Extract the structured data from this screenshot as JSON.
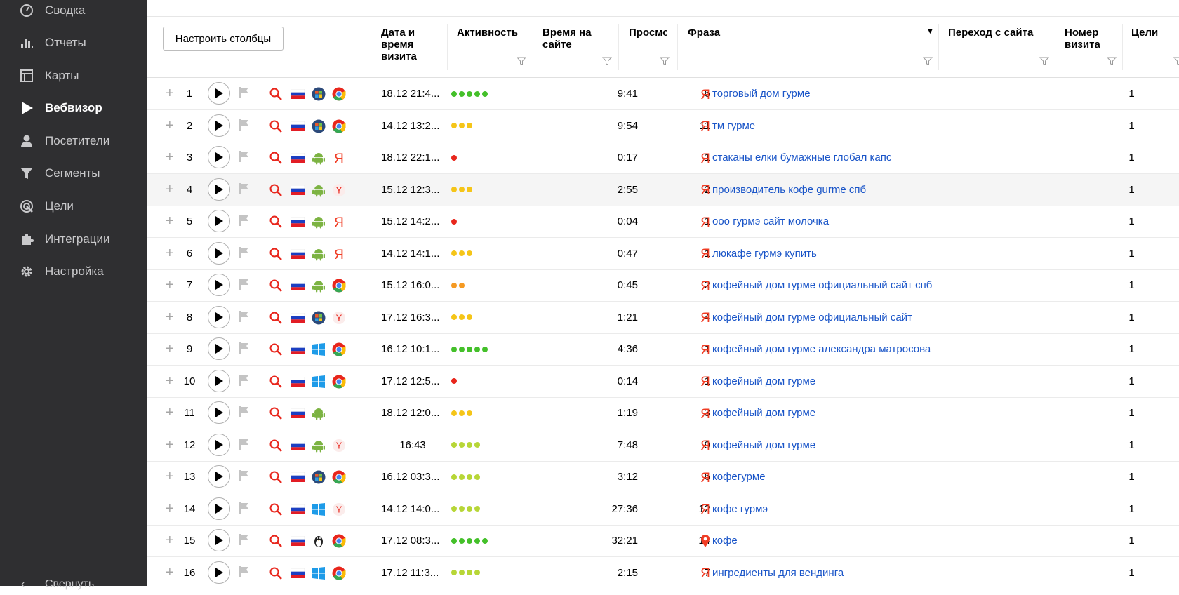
{
  "sidebar": {
    "items": [
      {
        "label": "Сводка",
        "icon": "gauge-icon"
      },
      {
        "label": "Отчеты",
        "icon": "bar-chart-icon"
      },
      {
        "label": "Карты",
        "icon": "map-layout-icon"
      },
      {
        "label": "Вебвизор",
        "icon": "play-icon",
        "active": true
      },
      {
        "label": "Посетители",
        "icon": "person-icon"
      },
      {
        "label": "Сегменты",
        "icon": "funnel-icon"
      },
      {
        "label": "Цели",
        "icon": "target-icon"
      },
      {
        "label": "Интеграции",
        "icon": "puzzle-icon"
      },
      {
        "label": "Настройка",
        "icon": "gear-icon"
      }
    ],
    "collapse_label": "Свернуть"
  },
  "toolbar": {
    "configure_columns": "Настроить столбцы"
  },
  "columns": {
    "datetime": "Дата и время визита",
    "activity": "Активность",
    "time_on_site": "Время на сайте",
    "views": "Просмотры",
    "phrase": "Фраза",
    "referrer": "Переход с сайта",
    "visit_number": "Номер визита",
    "goals": "Цели"
  },
  "colors": {
    "sidebar_bg": "#2f2f31",
    "link": "#1a55c8",
    "activity_green": "#44c02a",
    "activity_yellow": "#f5c518",
    "activity_red": "#e8261c",
    "activity_orange": "#f59a23",
    "activity_lime": "#b7d637"
  },
  "rows": [
    {
      "n": "1",
      "os": "windows7-icon",
      "browser": "chrome-icon",
      "dt": "18.12 21:4...",
      "act": 5,
      "act_color": "green",
      "time": "9:41",
      "views": "6",
      "src": "yandex-icon",
      "phrase": "торговый дом гурме",
      "visit": "1"
    },
    {
      "n": "2",
      "os": "windows7-icon",
      "browser": "chrome-icon",
      "dt": "14.12 13:2...",
      "act": 3,
      "act_color": "yellow",
      "time": "9:54",
      "views": "11",
      "src": "yandex-icon",
      "phrase": "тм гурме",
      "visit": "1"
    },
    {
      "n": "3",
      "os": "android-icon",
      "browser": "yandex-browser-icon",
      "dt": "18.12 22:1...",
      "act": 1,
      "act_color": "red",
      "time": "0:17",
      "views": "1",
      "src": "yandex-icon",
      "phrase": "стаканы елки бумажные глобал капс",
      "visit": "1"
    },
    {
      "n": "4",
      "os": "android-icon",
      "browser": "yandex-y-icon",
      "dt": "15.12 12:3...",
      "act": 3,
      "act_color": "yellow",
      "time": "2:55",
      "views": "2",
      "src": "yandex-icon",
      "phrase": "производитель кофе gurme спб",
      "visit": "1",
      "highlight": true
    },
    {
      "n": "5",
      "os": "android-icon",
      "browser": "yandex-browser-icon",
      "dt": "15.12 14:2...",
      "act": 1,
      "act_color": "red",
      "time": "0:04",
      "views": "1",
      "src": "yandex-icon",
      "phrase": "ооо гурмэ сайт молочка",
      "visit": "1"
    },
    {
      "n": "6",
      "os": "android-icon",
      "browser": "yandex-browser-icon",
      "dt": "14.12 14:1...",
      "act": 3,
      "act_color": "yellow",
      "time": "0:47",
      "views": "1",
      "src": "yandex-icon",
      "phrase": "люкафе гурмэ купить",
      "visit": "1"
    },
    {
      "n": "7",
      "os": "android-icon",
      "browser": "chrome-icon",
      "dt": "15.12 16:0...",
      "act": 2,
      "act_color": "orange",
      "time": "0:45",
      "views": "2",
      "src": "yandex-icon",
      "phrase": "кофейный дом гурме официальный сайт спб",
      "visit": "1"
    },
    {
      "n": "8",
      "os": "windows7-icon",
      "browser": "yandex-y-icon",
      "dt": "17.12 16:3...",
      "act": 3,
      "act_color": "yellow",
      "time": "1:21",
      "views": "4",
      "src": "yandex-icon",
      "phrase": "кофейный дом гурме официальный сайт",
      "visit": "1"
    },
    {
      "n": "9",
      "os": "windows10-icon",
      "browser": "chrome-icon",
      "dt": "16.12 10:1...",
      "act": 5,
      "act_color": "green",
      "time": "4:36",
      "views": "1",
      "src": "yandex-icon",
      "phrase": "кофейный дом гурме александра матросова",
      "visit": "1"
    },
    {
      "n": "10",
      "os": "windows10-icon",
      "browser": "chrome-icon",
      "dt": "17.12 12:5...",
      "act": 1,
      "act_color": "red",
      "time": "0:14",
      "views": "1",
      "src": "yandex-icon",
      "phrase": "кофейный дом гурме",
      "visit": "1"
    },
    {
      "n": "11",
      "os": "android-icon",
      "browser": "",
      "dt": "18.12 12:0...",
      "act": 3,
      "act_color": "yellow",
      "time": "1:19",
      "views": "3",
      "src": "yandex-icon",
      "phrase": "кофейный дом гурме",
      "visit": "1"
    },
    {
      "n": "12",
      "os": "android-icon",
      "browser": "yandex-y-icon",
      "dt": "16:43",
      "dt_center": true,
      "act": 4,
      "act_color": "lime",
      "time": "7:48",
      "views": "9",
      "src": "yandex-icon",
      "phrase": "кофейный дом гурме",
      "visit": "1"
    },
    {
      "n": "13",
      "os": "windows7-icon",
      "browser": "chrome-icon",
      "dt": "16.12 03:3...",
      "act": 4,
      "act_color": "lime",
      "time": "3:12",
      "views": "6",
      "src": "yandex-icon",
      "phrase": "кофегурме",
      "visit": "1"
    },
    {
      "n": "14",
      "os": "windows10-icon",
      "browser": "yandex-y-icon",
      "dt": "14.12 14:0...",
      "act": 4,
      "act_color": "lime",
      "time": "27:36",
      "views": "12",
      "src": "yandex-icon",
      "phrase": "кофе гурмэ",
      "visit": "1"
    },
    {
      "n": "15",
      "os": "linux-icon",
      "browser": "chrome-icon",
      "dt": "17.12 08:3...",
      "act": 5,
      "act_color": "green",
      "time": "32:21",
      "views": "14",
      "src": "maps-pin-icon",
      "phrase": "кофе",
      "visit": "1"
    },
    {
      "n": "16",
      "os": "windows10-icon",
      "browser": "chrome-icon",
      "dt": "17.12 11:3...",
      "act": 4,
      "act_color": "lime",
      "time": "2:15",
      "views": "7",
      "src": "yandex-icon",
      "phrase": "ингредиенты для вендинга",
      "visit": "1"
    }
  ]
}
